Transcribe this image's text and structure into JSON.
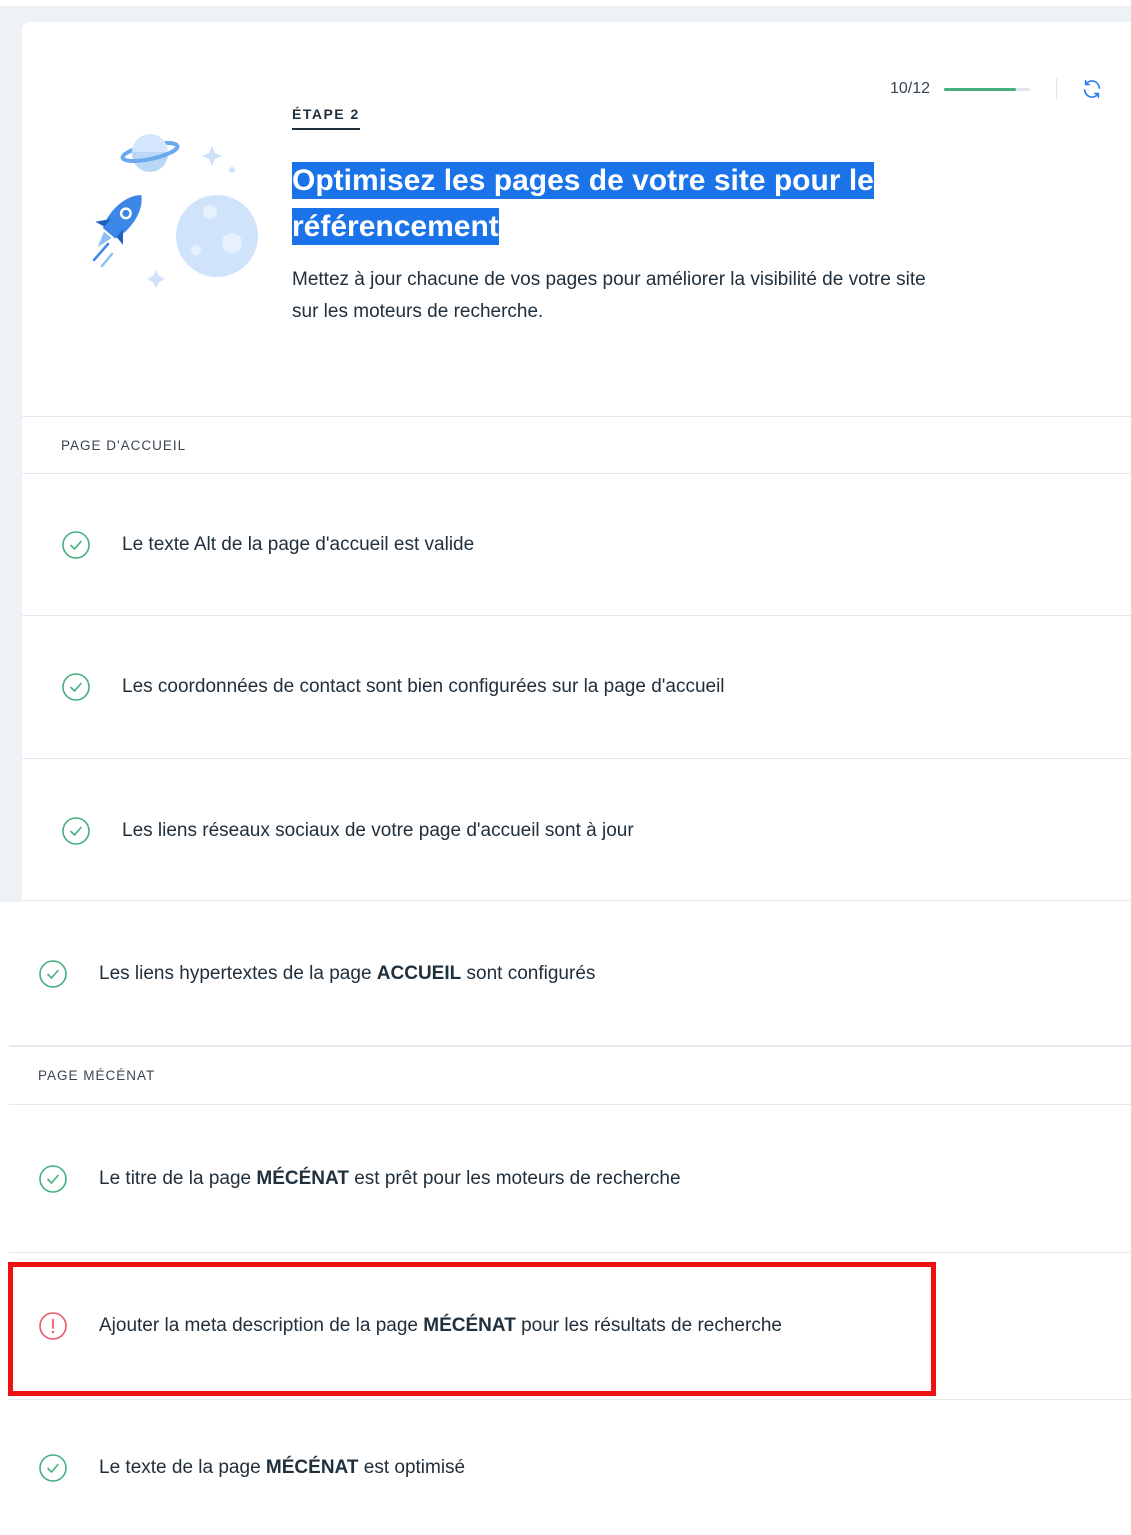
{
  "progress": {
    "text": "10/12",
    "fraction": 0.8333
  },
  "header": {
    "step_label": "ÉTAPE 2",
    "title": "Optimisez les pages de votre site pour le référencement",
    "subtitle": "Mettez à jour chacune de vos pages pour améliorer la visibilité de votre site sur les moteurs de recherche."
  },
  "sections": [
    {
      "title": "PAGE D'ACCUEIL",
      "items": [
        {
          "status": "success",
          "text": "Le texte Alt de la page d'accueil est valide"
        },
        {
          "status": "success",
          "text": "Les coordonnées de contact sont bien configurées sur la page d'accueil"
        },
        {
          "status": "success",
          "text": "Les liens réseaux sociaux de votre page d'accueil sont à jour"
        },
        {
          "status": "success",
          "prefix": "Les liens hypertextes de la page ",
          "bold": "ACCUEIL",
          "suffix": " sont configurés"
        }
      ]
    },
    {
      "title": "PAGE MÉCÉNAT",
      "items": [
        {
          "status": "success",
          "prefix": "Le titre de la page ",
          "bold": "MÉCÉNAT",
          "suffix": " est prêt pour les moteurs de recherche"
        },
        {
          "status": "warning",
          "prefix": "Ajouter la meta description de la page ",
          "bold": "MÉCÉNAT",
          "suffix": " pour les résultats de recherche"
        },
        {
          "status": "success",
          "prefix": "Le texte de la page ",
          "bold": "MÉCÉNAT",
          "suffix": " est optimisé"
        }
      ]
    }
  ],
  "icons": {
    "success": "check-circle-icon",
    "warning": "exclamation-circle-icon",
    "refresh": "refresh-icon"
  },
  "colors": {
    "success": "#45b07e",
    "warning": "#e85a6a",
    "title_highlight": "#1a73e8",
    "annotation": "#ee1111"
  }
}
